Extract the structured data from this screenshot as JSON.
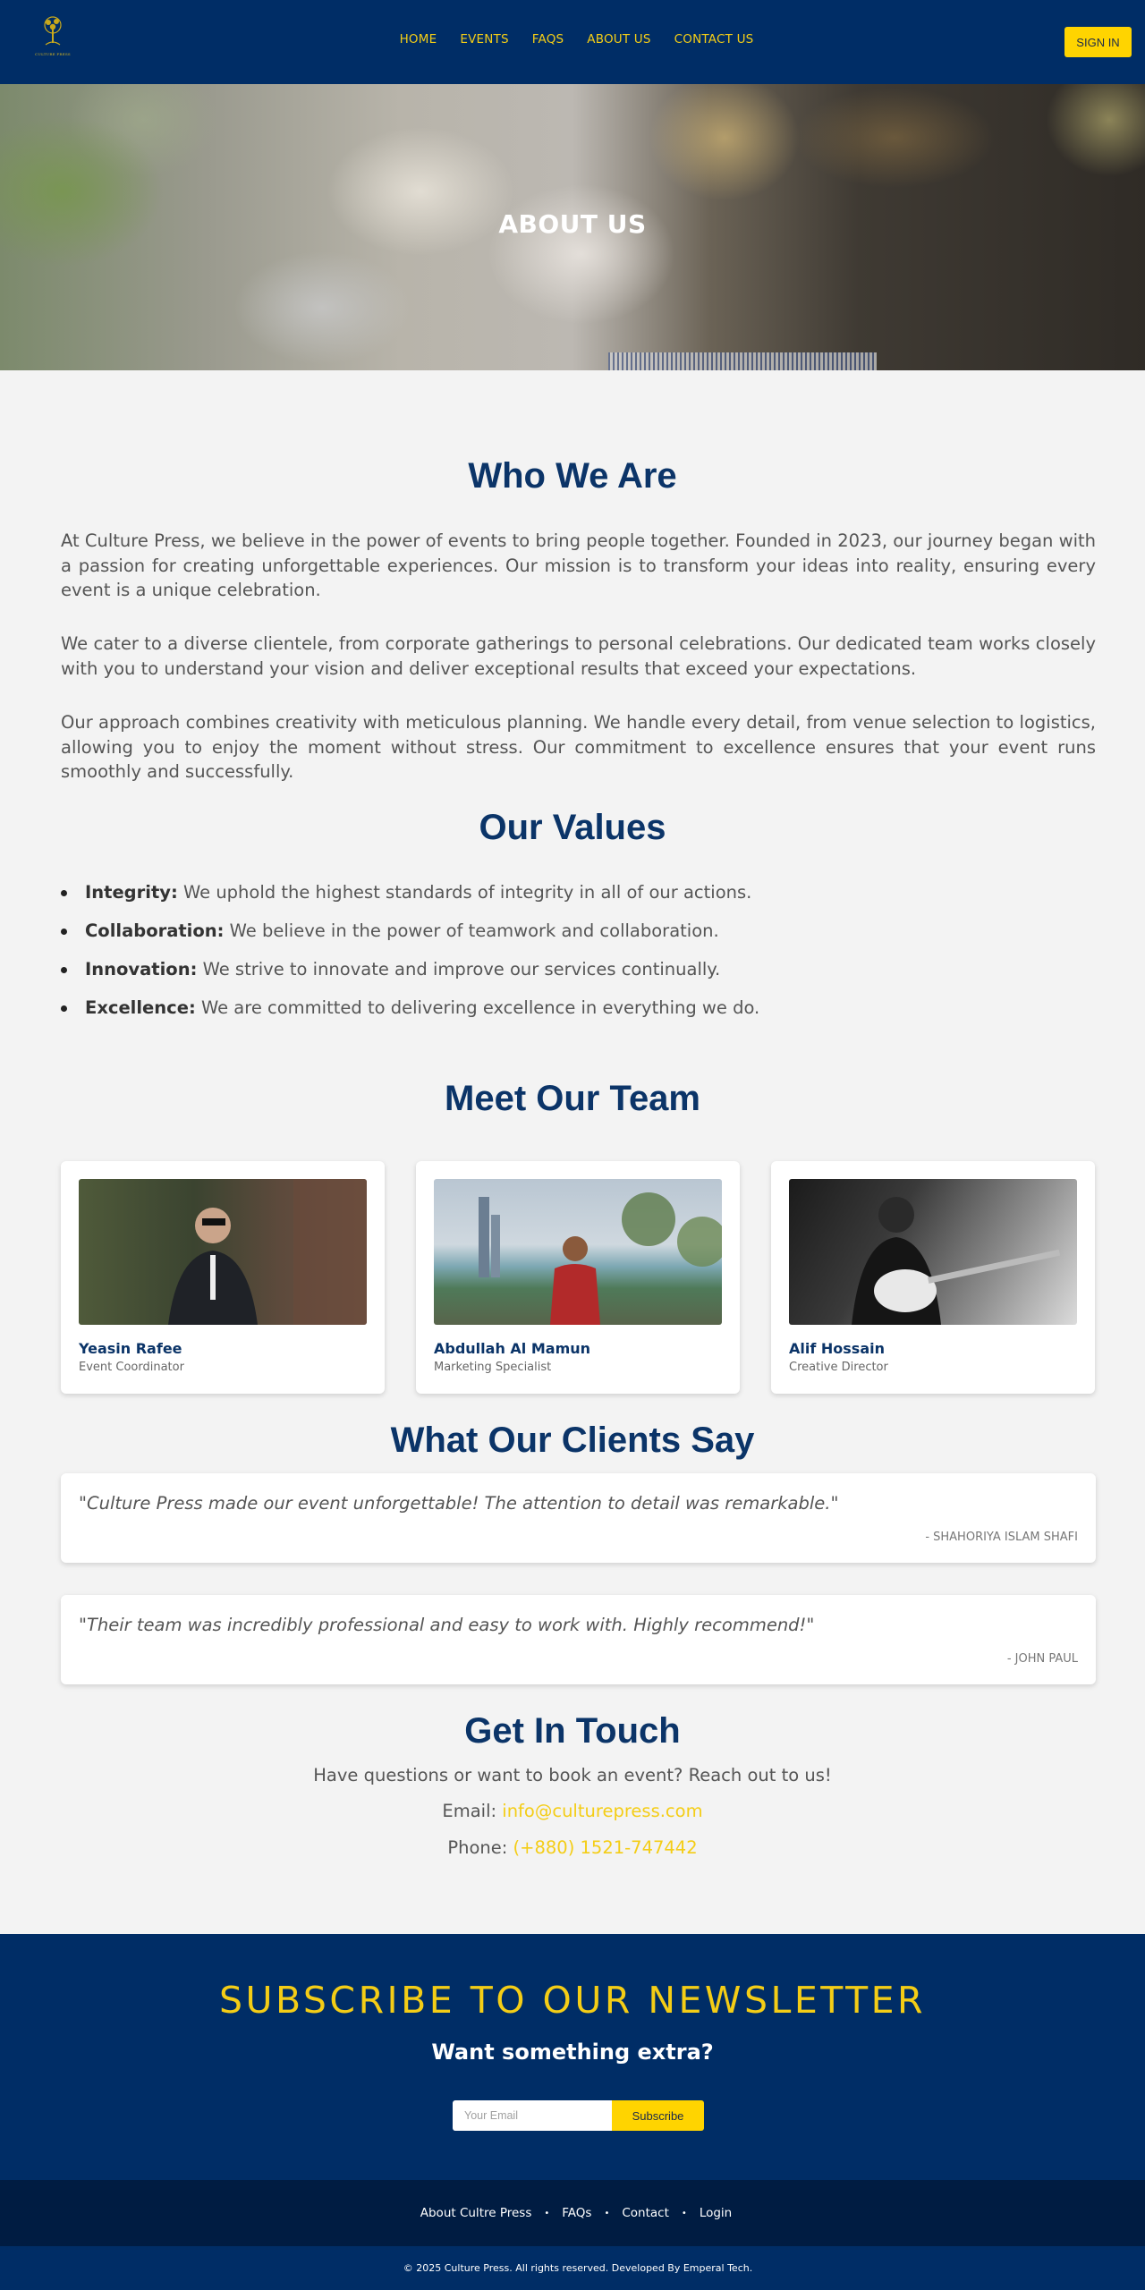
{
  "brand": {
    "logo_text": "CULTURE PRESS"
  },
  "nav": {
    "links": [
      "HOME",
      "EVENTS",
      "FAQS",
      "ABOUT US",
      "CONTACT US"
    ],
    "signin_label": "SIGN IN"
  },
  "hero": {
    "title": "ABOUT US"
  },
  "who": {
    "title": "Who We Are",
    "paragraphs": [
      "At Culture Press, we believe in the power of events to bring people together. Founded in 2023, our journey began with a passion for creating unforgettable experiences. Our mission is to transform your ideas into reality, ensuring every event is a unique celebration.",
      "We cater to a diverse clientele, from corporate gatherings to personal celebrations. Our dedicated team works closely with you to understand your vision and deliver exceptional results that exceed your expectations.",
      "Our approach combines creativity with meticulous planning. We handle every detail, from venue selection to logistics, allowing you to enjoy the moment without stress. Our commitment to excellence ensures that your event runs smoothly and successfully."
    ]
  },
  "values": {
    "title": "Our Values",
    "items": [
      {
        "term": "Integrity:",
        "text": " We uphold the highest standards of integrity in all of our actions."
      },
      {
        "term": "Collaboration:",
        "text": " We believe in the power of teamwork and collaboration."
      },
      {
        "term": "Innovation:",
        "text": " We strive to innovate and improve our services continually."
      },
      {
        "term": "Excellence:",
        "text": " We are committed to delivering excellence in everything we do."
      }
    ]
  },
  "team": {
    "title": "Meet Our Team",
    "members": [
      {
        "name": "Yeasin Rafee",
        "role": "Event Coordinator"
      },
      {
        "name": "Abdullah Al Mamun",
        "role": "Marketing Specialist"
      },
      {
        "name": "Alif Hossain",
        "role": "Creative Director"
      }
    ]
  },
  "testimonials": {
    "title": "What Our Clients Say",
    "items": [
      {
        "quote": "\"Culture Press made our event unforgettable! The attention to detail was remarkable.\"",
        "author": "- Shahoriya Islam Shafi"
      },
      {
        "quote": "\"Their team was incredibly professional and easy to work with. Highly recommend!\"",
        "author": "- John Paul"
      }
    ]
  },
  "contact": {
    "title": "Get In Touch",
    "intro": "Have questions or want to book an event? Reach out to us!",
    "email_label": "Email: ",
    "email": "info@culturepress.com",
    "phone_label": "Phone: ",
    "phone": "(+880) 1521-747442"
  },
  "newsletter": {
    "title": "SUBSCRIBE TO OUR NEWSLETTER",
    "subtitle": "Want something extra?",
    "placeholder": "Your Email",
    "button": "Subscribe"
  },
  "footer": {
    "links": [
      "About Cultre Press",
      "FAQs",
      "Contact",
      "Login"
    ],
    "copyright": "© 2025 Culture Press. All rights reserved. Developed By Emperal Tech."
  },
  "colors": {
    "navy": "#002d66",
    "accent": "#f4cd16",
    "heading": "#0b3468"
  }
}
